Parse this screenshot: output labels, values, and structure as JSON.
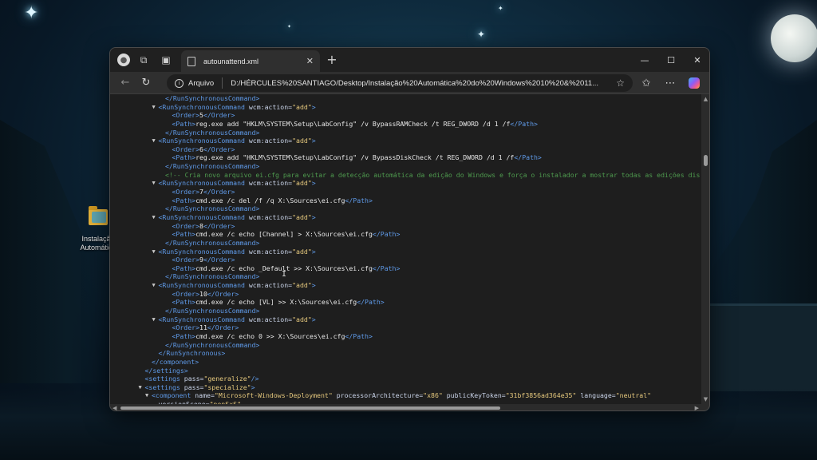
{
  "desktop": {
    "icon_label": "Instalação Automática"
  },
  "browser": {
    "tab_title": "autounattend.xml",
    "address_label": "Arquivo",
    "url": "D:/HÉRCULES%20SANTIAGO/Desktop/Instalação%20Automática%20do%20Windows%2010%20&%2011..."
  },
  "icons": [
    "profile-icon",
    "workspaces-icon",
    "tab-actions-icon",
    "doc-icon",
    "close-icon",
    "plus-icon",
    "minimize-icon",
    "maximize-icon",
    "back-icon",
    "refresh-icon",
    "info-icon",
    "star-icon",
    "favorites-icon",
    "more-icon",
    "copilot-icon"
  ],
  "colors": {
    "tag": "#5f9ae8",
    "value": "#e4c77c",
    "comment": "#4e9a4e",
    "editor_bg": "#1e1e1e"
  },
  "code_lines": [
    {
      "indent": 6,
      "tri": false,
      "parts": [
        {
          "c": "tag",
          "t": "</RunSynchronousCommand>"
        }
      ]
    },
    {
      "indent": 5,
      "tri": true,
      "parts": [
        {
          "c": "tag",
          "t": "<RunSynchronousCommand "
        },
        {
          "c": "attr",
          "t": "wcm:action="
        },
        {
          "c": "val",
          "t": "\"add\""
        },
        {
          "c": "tag",
          "t": ">"
        }
      ]
    },
    {
      "indent": 7,
      "tri": false,
      "parts": [
        {
          "c": "tag",
          "t": "<Order>"
        },
        {
          "c": "txt",
          "t": "5"
        },
        {
          "c": "tag",
          "t": "</Order>"
        }
      ]
    },
    {
      "indent": 7,
      "tri": false,
      "parts": [
        {
          "c": "tag",
          "t": "<Path>"
        },
        {
          "c": "txt",
          "t": "reg.exe add \"HKLM\\SYSTEM\\Setup\\LabConfig\" /v BypassRAMCheck /t REG_DWORD /d 1 /f"
        },
        {
          "c": "tag",
          "t": "</Path>"
        }
      ]
    },
    {
      "indent": 6,
      "tri": false,
      "parts": [
        {
          "c": "tag",
          "t": "</RunSynchronousCommand>"
        }
      ]
    },
    {
      "indent": 5,
      "tri": true,
      "parts": [
        {
          "c": "tag",
          "t": "<RunSynchronousCommand "
        },
        {
          "c": "attr",
          "t": "wcm:action="
        },
        {
          "c": "val",
          "t": "\"add\""
        },
        {
          "c": "tag",
          "t": ">"
        }
      ]
    },
    {
      "indent": 7,
      "tri": false,
      "parts": [
        {
          "c": "tag",
          "t": "<Order>"
        },
        {
          "c": "txt",
          "t": "6"
        },
        {
          "c": "tag",
          "t": "</Order>"
        }
      ]
    },
    {
      "indent": 7,
      "tri": false,
      "parts": [
        {
          "c": "tag",
          "t": "<Path>"
        },
        {
          "c": "txt",
          "t": "reg.exe add \"HKLM\\SYSTEM\\Setup\\LabConfig\" /v BypassDiskCheck /t REG_DWORD /d 1 /f"
        },
        {
          "c": "tag",
          "t": "</Path>"
        }
      ]
    },
    {
      "indent": 6,
      "tri": false,
      "parts": [
        {
          "c": "tag",
          "t": "</RunSynchronousCommand>"
        }
      ]
    },
    {
      "indent": 6,
      "tri": false,
      "parts": [
        {
          "c": "cmt",
          "t": "<!-- Cria novo arquivo ei.cfg para evitar a detecção automática da edição do Windows e força o instalador a mostrar todas as edições dis"
        }
      ]
    },
    {
      "indent": 5,
      "tri": true,
      "parts": [
        {
          "c": "tag",
          "t": "<RunSynchronousCommand "
        },
        {
          "c": "attr",
          "t": "wcm:action="
        },
        {
          "c": "val",
          "t": "\"add\""
        },
        {
          "c": "tag",
          "t": ">"
        }
      ]
    },
    {
      "indent": 7,
      "tri": false,
      "parts": [
        {
          "c": "tag",
          "t": "<Order>"
        },
        {
          "c": "txt",
          "t": "7"
        },
        {
          "c": "tag",
          "t": "</Order>"
        }
      ]
    },
    {
      "indent": 7,
      "tri": false,
      "parts": [
        {
          "c": "tag",
          "t": "<Path>"
        },
        {
          "c": "txt",
          "t": "cmd.exe /c del /f /q X:\\Sources\\ei.cfg"
        },
        {
          "c": "tag",
          "t": "</Path>"
        }
      ]
    },
    {
      "indent": 6,
      "tri": false,
      "parts": [
        {
          "c": "tag",
          "t": "</RunSynchronousCommand>"
        }
      ]
    },
    {
      "indent": 5,
      "tri": true,
      "parts": [
        {
          "c": "tag",
          "t": "<RunSynchronousCommand "
        },
        {
          "c": "attr",
          "t": "wcm:action="
        },
        {
          "c": "val",
          "t": "\"add\""
        },
        {
          "c": "tag",
          "t": ">"
        }
      ]
    },
    {
      "indent": 7,
      "tri": false,
      "parts": [
        {
          "c": "tag",
          "t": "<Order>"
        },
        {
          "c": "txt",
          "t": "8"
        },
        {
          "c": "tag",
          "t": "</Order>"
        }
      ]
    },
    {
      "indent": 7,
      "tri": false,
      "parts": [
        {
          "c": "tag",
          "t": "<Path>"
        },
        {
          "c": "txt",
          "t": "cmd.exe /c echo [Channel] > X:\\Sources\\ei.cfg"
        },
        {
          "c": "tag",
          "t": "</Path>"
        }
      ]
    },
    {
      "indent": 6,
      "tri": false,
      "parts": [
        {
          "c": "tag",
          "t": "</RunSynchronousCommand>"
        }
      ]
    },
    {
      "indent": 5,
      "tri": true,
      "parts": [
        {
          "c": "tag",
          "t": "<RunSynchronousCommand "
        },
        {
          "c": "attr",
          "t": "wcm:action="
        },
        {
          "c": "val",
          "t": "\"add\""
        },
        {
          "c": "tag",
          "t": ">"
        }
      ]
    },
    {
      "indent": 7,
      "tri": false,
      "parts": [
        {
          "c": "tag",
          "t": "<Order>"
        },
        {
          "c": "txt",
          "t": "9"
        },
        {
          "c": "tag",
          "t": "</Order>"
        }
      ]
    },
    {
      "indent": 7,
      "tri": false,
      "parts": [
        {
          "c": "tag",
          "t": "<Path>"
        },
        {
          "c": "txt",
          "t": "cmd.exe /c echo _Default >> X:\\Sources\\ei.cfg"
        },
        {
          "c": "tag",
          "t": "</Path>"
        }
      ]
    },
    {
      "indent": 6,
      "tri": false,
      "parts": [
        {
          "c": "tag",
          "t": "</RunSynchronousCommand>"
        }
      ]
    },
    {
      "indent": 5,
      "tri": true,
      "parts": [
        {
          "c": "tag",
          "t": "<RunSynchronousCommand "
        },
        {
          "c": "attr",
          "t": "wcm:action="
        },
        {
          "c": "val",
          "t": "\"add\""
        },
        {
          "c": "tag",
          "t": ">"
        }
      ]
    },
    {
      "indent": 7,
      "tri": false,
      "parts": [
        {
          "c": "tag",
          "t": "<Order>"
        },
        {
          "c": "txt",
          "t": "10"
        },
        {
          "c": "tag",
          "t": "</Order>"
        }
      ]
    },
    {
      "indent": 7,
      "tri": false,
      "parts": [
        {
          "c": "tag",
          "t": "<Path>"
        },
        {
          "c": "txt",
          "t": "cmd.exe /c echo [VL] >> X:\\Sources\\ei.cfg"
        },
        {
          "c": "tag",
          "t": "</Path>"
        }
      ]
    },
    {
      "indent": 6,
      "tri": false,
      "parts": [
        {
          "c": "tag",
          "t": "</RunSynchronousCommand>"
        }
      ]
    },
    {
      "indent": 5,
      "tri": true,
      "parts": [
        {
          "c": "tag",
          "t": "<RunSynchronousCommand "
        },
        {
          "c": "attr",
          "t": "wcm:action="
        },
        {
          "c": "val",
          "t": "\"add\""
        },
        {
          "c": "tag",
          "t": ">"
        }
      ]
    },
    {
      "indent": 7,
      "tri": false,
      "parts": [
        {
          "c": "tag",
          "t": "<Order>"
        },
        {
          "c": "txt",
          "t": "11"
        },
        {
          "c": "tag",
          "t": "</Order>"
        }
      ]
    },
    {
      "indent": 7,
      "tri": false,
      "parts": [
        {
          "c": "tag",
          "t": "<Path>"
        },
        {
          "c": "txt",
          "t": "cmd.exe /c echo 0 >> X:\\Sources\\ei.cfg"
        },
        {
          "c": "tag",
          "t": "</Path>"
        }
      ]
    },
    {
      "indent": 6,
      "tri": false,
      "parts": [
        {
          "c": "tag",
          "t": "</RunSynchronousCommand>"
        }
      ]
    },
    {
      "indent": 5,
      "tri": false,
      "parts": [
        {
          "c": "tag",
          "t": "</RunSynchronous>"
        }
      ]
    },
    {
      "indent": 4,
      "tri": false,
      "parts": [
        {
          "c": "tag",
          "t": "</component>"
        }
      ]
    },
    {
      "indent": 3,
      "tri": false,
      "parts": [
        {
          "c": "tag",
          "t": "</settings>"
        }
      ]
    },
    {
      "indent": 3,
      "tri": false,
      "parts": [
        {
          "c": "tag",
          "t": "<settings "
        },
        {
          "c": "attr",
          "t": "pass="
        },
        {
          "c": "val",
          "t": "\"generalize\""
        },
        {
          "c": "tag",
          "t": "/>"
        }
      ]
    },
    {
      "indent": 3,
      "tri": true,
      "parts": [
        {
          "c": "tag",
          "t": "<settings "
        },
        {
          "c": "attr",
          "t": "pass="
        },
        {
          "c": "val",
          "t": "\"specialize\""
        },
        {
          "c": "tag",
          "t": ">"
        }
      ]
    },
    {
      "indent": 4,
      "tri": true,
      "parts": [
        {
          "c": "tag",
          "t": "<component "
        },
        {
          "c": "attr",
          "t": "name="
        },
        {
          "c": "val",
          "t": "\"Microsoft-Windows-Deployment\""
        },
        {
          "c": "attr",
          "t": " processorArchitecture="
        },
        {
          "c": "val",
          "t": "\"x86\""
        },
        {
          "c": "attr",
          "t": " publicKeyToken="
        },
        {
          "c": "val",
          "t": "\"31bf3856ad364e35\""
        },
        {
          "c": "attr",
          "t": " language="
        },
        {
          "c": "val",
          "t": "\"neutral\""
        }
      ]
    },
    {
      "indent": 5,
      "tri": false,
      "parts": [
        {
          "c": "attr",
          "t": "versionScope="
        },
        {
          "c": "val",
          "t": "\"nonSxS\""
        }
      ]
    }
  ]
}
